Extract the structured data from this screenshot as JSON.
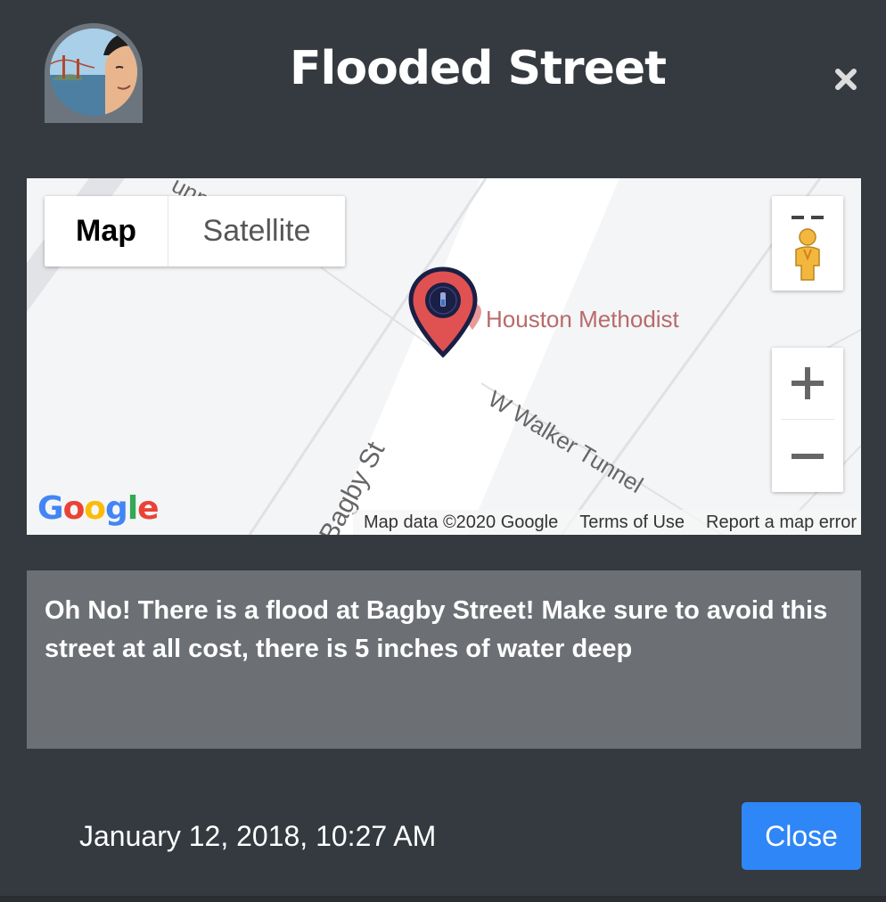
{
  "modal": {
    "title": "Flooded Street",
    "description": "Oh No! There is a flood at Bagby Street! Make sure to avoid this street at all cost, there is 5 inches of water deep",
    "timestamp": "January 12, 2018, 10:27 AM",
    "close_label": "Close"
  },
  "map": {
    "type_buttons": [
      "Map",
      "Satellite"
    ],
    "active_type": "Map",
    "poi_label": "Houston Methodist",
    "street_labels": [
      "W Walker Tunnel",
      "Bagby St"
    ],
    "street_label_partial_top": "unne",
    "google_logo_letters": [
      "G",
      "o",
      "o",
      "g",
      "l",
      "e"
    ],
    "attribution": {
      "data": "Map data ©2020 Google",
      "terms": "Terms of Use",
      "report": "Report a map error"
    },
    "marker_color": "#e05252",
    "marker_outline": "#1a1f45"
  },
  "colors": {
    "background": "#343a40",
    "description_bg": "#6c7075",
    "primary_button": "#2f86f6",
    "avatar_frame": "#6c757d"
  },
  "icons": {
    "close": "close-x-icon",
    "pegman": "pegman-icon",
    "zoom_in": "plus-icon",
    "zoom_out": "minus-icon",
    "marker": "map-marker-icon"
  }
}
